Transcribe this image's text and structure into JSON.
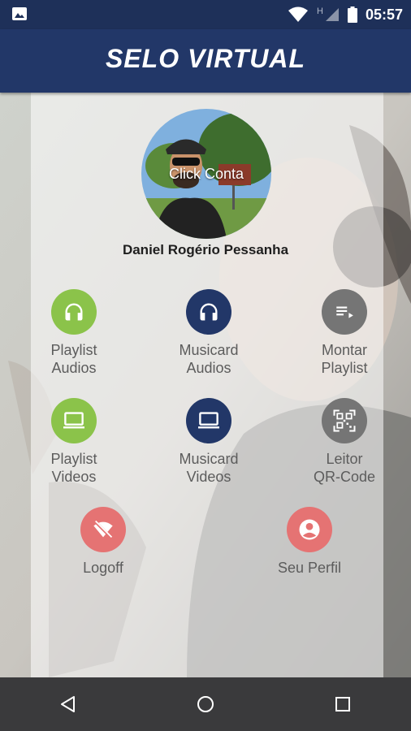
{
  "status_bar": {
    "time": "05:57",
    "icons": [
      "image-icon",
      "wifi-icon",
      "h-signal-icon",
      "cell-signal-icon",
      "battery-icon"
    ],
    "signal_letter": "H"
  },
  "app_bar": {
    "title": "SELO VIRTUAL"
  },
  "profile": {
    "avatar_label": "Click Conta",
    "name": "Daniel Rogério Pessanha"
  },
  "menu": [
    {
      "label": "Playlist\nAudios",
      "icon": "headphones-icon",
      "color": "#8bc34a"
    },
    {
      "label": "Musicard\nAudios",
      "icon": "headphones-icon",
      "color": "#223768"
    },
    {
      "label": "Montar\nPlaylist",
      "icon": "playlist-add-icon",
      "color": "#757575"
    },
    {
      "label": "Playlist\nVideos",
      "icon": "laptop-icon",
      "color": "#8bc34a"
    },
    {
      "label": "Musicard\nVideos",
      "icon": "laptop-icon",
      "color": "#223768"
    },
    {
      "label": "Leitor\nQR-Code",
      "icon": "qr-code-icon",
      "color": "#757575"
    },
    {
      "label": "Logoff",
      "icon": "wifi-off-icon",
      "color": "#e57373"
    },
    {
      "label": "Seu Perfil",
      "icon": "account-circle-icon",
      "color": "#e57373"
    }
  ],
  "nav_bar": {
    "icons": [
      "back-icon",
      "home-icon",
      "recents-icon"
    ]
  },
  "colors": {
    "primary": "#223768",
    "status": "#1e3059",
    "green": "#8bc34a",
    "gray": "#757575",
    "red": "#e57373"
  }
}
